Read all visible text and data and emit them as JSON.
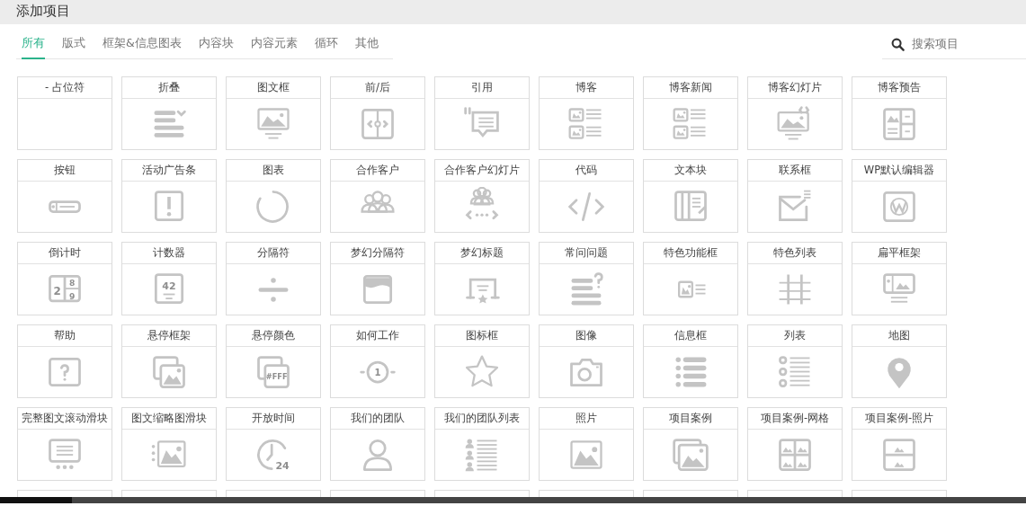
{
  "window": {
    "title": "添加项目"
  },
  "tabs": [
    {
      "label": "所有",
      "selected": true
    },
    {
      "label": "版式",
      "selected": false
    },
    {
      "label": "框架&信息图表",
      "selected": false
    },
    {
      "label": "内容块",
      "selected": false
    },
    {
      "label": "内容元素",
      "selected": false
    },
    {
      "label": "循环",
      "selected": false
    },
    {
      "label": "其他",
      "selected": false
    }
  ],
  "search": {
    "placeholder": "搜索项目"
  },
  "elements": [
    {
      "label": "- 占位符"
    },
    {
      "label": "折叠"
    },
    {
      "label": "图文框"
    },
    {
      "label": "前/后"
    },
    {
      "label": "引用"
    },
    {
      "label": "博客"
    },
    {
      "label": "博客新闻"
    },
    {
      "label": "博客幻灯片"
    },
    {
      "label": "博客预告"
    },
    {
      "label": "按钮"
    },
    {
      "label": "活动广告条"
    },
    {
      "label": "图表"
    },
    {
      "label": "合作客户"
    },
    {
      "label": "合作客户幻灯片"
    },
    {
      "label": "代码"
    },
    {
      "label": "文本块"
    },
    {
      "label": "联系框"
    },
    {
      "label": "WP默认编辑器"
    },
    {
      "label": "倒计时",
      "icon_texts": [
        "2",
        "8",
        "9"
      ]
    },
    {
      "label": "计数器",
      "icon_texts": [
        "42"
      ]
    },
    {
      "label": "分隔符"
    },
    {
      "label": "梦幻分隔符"
    },
    {
      "label": "梦幻标题"
    },
    {
      "label": "常问问题"
    },
    {
      "label": "特色功能框"
    },
    {
      "label": "特色列表"
    },
    {
      "label": "扁平框架"
    },
    {
      "label": "帮助"
    },
    {
      "label": "悬停框架"
    },
    {
      "label": "悬停颜色",
      "icon_texts": [
        "#FFF"
      ]
    },
    {
      "label": "如何工作",
      "icon_texts": [
        "1"
      ]
    },
    {
      "label": "图标框"
    },
    {
      "label": "图像"
    },
    {
      "label": "信息框"
    },
    {
      "label": "列表"
    },
    {
      "label": "地图"
    },
    {
      "label": "完整图文滚动滑块"
    },
    {
      "label": "图文缩略图滑块"
    },
    {
      "label": "开放时间",
      "icon_texts": [
        "24"
      ]
    },
    {
      "label": "我们的团队"
    },
    {
      "label": "我们的团队列表"
    },
    {
      "label": "照片"
    },
    {
      "label": "项目案例"
    },
    {
      "label": "项目案例-网格"
    },
    {
      "label": "项目案例-照片"
    }
  ]
}
